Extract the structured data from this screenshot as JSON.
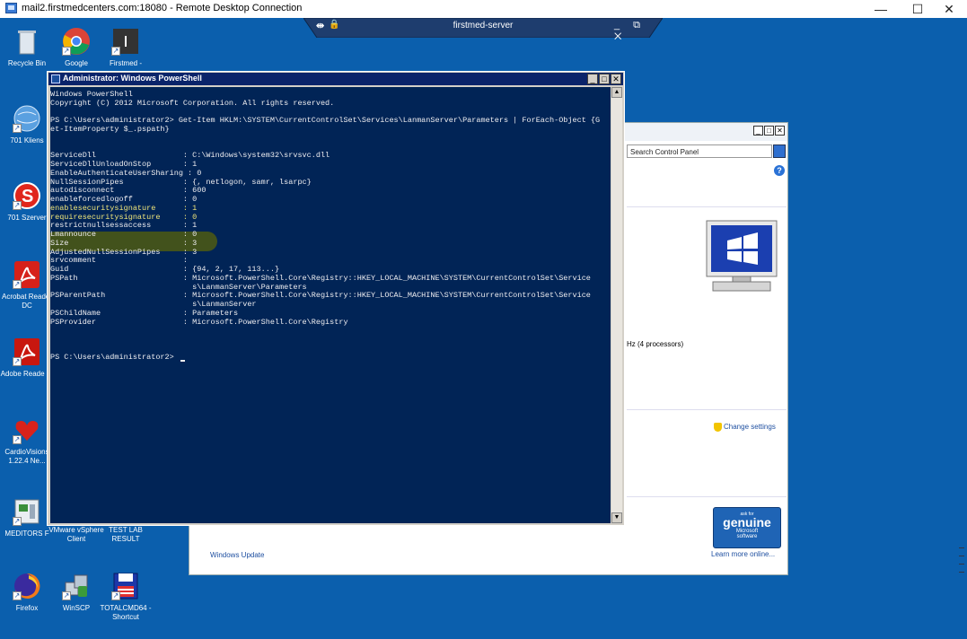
{
  "rdp": {
    "title": "mail2.firstmedcenters.com:18080 - Remote Desktop Connection",
    "minimize": "—",
    "maximize": "☐",
    "close": "✕"
  },
  "connection_bar": {
    "title": "firstmed-server",
    "pin": "⇹",
    "lock": "🔒",
    "controls": "_ ⧉ ✕"
  },
  "desktop_icons": [
    {
      "label": "Recycle Bin",
      "icon": "recycle-bin-icon"
    },
    {
      "label": "Google",
      "icon": "chrome-icon"
    },
    {
      "label": "Firstmed -",
      "icon": "shortcut-icon"
    },
    {
      "label": "701 Kliens",
      "icon": "globe-icon"
    },
    {
      "label": "701 Szerver",
      "icon": "s-app-icon"
    },
    {
      "label": "Acrobat Reader DC",
      "icon": "acrobat-icon"
    },
    {
      "label": "Adobe Reade XI",
      "icon": "acrobat-icon"
    },
    {
      "label": "CardioVisions 1.22.4 Ne...",
      "icon": "cardio-icon"
    },
    {
      "label": "MEDITORS F",
      "icon": "app-icon"
    },
    {
      "label": "VMware vSphere Client",
      "icon": "vmware-icon"
    },
    {
      "label": "TEST LAB RESULT",
      "icon": "document-icon"
    },
    {
      "label": "Firefox",
      "icon": "firefox-icon"
    },
    {
      "label": "WinSCP",
      "icon": "winscp-icon"
    },
    {
      "label": "TOTALCMD64 - Shortcut",
      "icon": "floppy-icon"
    }
  ],
  "control_panel": {
    "search_placeholder": "Search Control Panel",
    "processor": "Hz  (4 processors)",
    "change_settings": "Change settings",
    "windows_update": "Windows Update",
    "genuine_top": "ask for",
    "genuine_mid": "genuine",
    "genuine_ms": "Microsoft",
    "genuine_sw": "software",
    "learn_more": "Learn more online..."
  },
  "powershell": {
    "title": "Administrator: Windows PowerShell",
    "lines": [
      "Windows PowerShell",
      "Copyright (C) 2012 Microsoft Corporation. All rights reserved.",
      "",
      "PS C:\\Users\\administrator2> Get-Item HKLM:\\SYSTEM\\CurrentControlSet\\Services\\LanmanServer\\Parameters | ForEach-Object {G",
      "et-ItemProperty $_.pspath}",
      "",
      "",
      "ServiceDll                   : C:\\Windows\\system32\\srvsvc.dll",
      "ServiceDllUnloadOnStop       : 1",
      "EnableAuthenticateUserSharing : 0",
      "NullSessionPipes             : {, netlogon, samr, lsarpc}",
      "autodisconnect               : 600",
      "enableforcedlogoff           : 0",
      "enablesecuritysignature      : 1",
      "requiresecuritysignature     : 0",
      "restrictnullsessaccess       : 1",
      "Lmannounce                   : 0",
      "Size                         : 3",
      "AdjustedNullSessionPipes     : 3",
      "srvcomment                   :",
      "Guid                         : {94, 2, 17, 113...}",
      "PSPath                       : Microsoft.PowerShell.Core\\Registry::HKEY_LOCAL_MACHINE\\SYSTEM\\CurrentControlSet\\Service",
      "                               s\\LanmanServer\\Parameters",
      "PSParentPath                 : Microsoft.PowerShell.Core\\Registry::HKEY_LOCAL_MACHINE\\SYSTEM\\CurrentControlSet\\Service",
      "                               s\\LanmanServer",
      "PSChildName                  : Parameters",
      "PSProvider                   : Microsoft.PowerShell.Core\\Registry",
      "",
      "",
      "",
      "PS C:\\Users\\administrator2> "
    ]
  },
  "colors": {
    "desktop": "#0b5fad",
    "console": "#012456",
    "highlight": "#4d5a12"
  }
}
